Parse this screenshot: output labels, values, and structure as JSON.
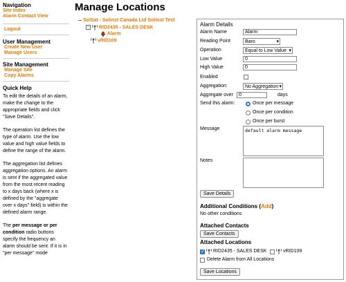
{
  "sidebar": {
    "navigation": {
      "title": "Navigation",
      "links": [
        "Site Index",
        "Alarm Contact View"
      ]
    },
    "logout": "Logout",
    "user_management": {
      "title": "User Management",
      "links": [
        "Create New User",
        "Manage Users"
      ]
    },
    "site_management": {
      "title": "Site Management",
      "links": [
        "Manage Site",
        "Copy Alarms"
      ]
    },
    "quick_help": {
      "title": "Quick Help",
      "p1": "To edit the details of an alarm, make the change to the appropriate fields and click \"Save Details\".",
      "p2": "The operation list defines the type of alarm. Use the low value and high value fields to define the range of the alarm.",
      "p3": "The aggregation list defines aggregation options. An alarm is sent if the aggregated value from the most recent reading to x days back (where x is defined by the \"aggregate over x days\" field) is within the defined alarm range.",
      "p4_bold": "per message or per condition",
      "p4_pre": "The ",
      "p4_post": " radio buttons specify the frequency an alarm should be sent. If it is in \"per message\" mode"
    }
  },
  "page_title": "Manage Locations",
  "tree": {
    "root": "SolSat - Solinst Canada Ltd Solinst Test",
    "site": "RID2435 - SALES DESK",
    "alarm": "Alarm",
    "device": "vRID109"
  },
  "form": {
    "header": "Alarm Details",
    "alarm_name_label": "Alarm Name",
    "alarm_name_value": "Alarm",
    "reading_point_label": "Reading Point",
    "reading_point_value": "Baro",
    "operation_label": "Operation",
    "operation_value": "Equal to Low Value",
    "low_value_label": "Low Value",
    "low_value_value": "0",
    "high_value_label": "High Value",
    "high_value_value": "0",
    "enabled_label": "Enabled",
    "aggregation_label": "Aggregation:",
    "aggregation_value": "No Aggregation",
    "aggregate_over_label": "Aggregate over",
    "aggregate_over_value": "0",
    "days_label": "days",
    "send_label": "Send this alarm:",
    "send_options": [
      "Once per message",
      "Once per condition",
      "Once per burst"
    ],
    "message_label": "Message",
    "message_value": "default alarm message",
    "notes_label": "Notes",
    "notes_value": "",
    "save_details": "Save Details",
    "additional_conditions_title": "Additional Conditions",
    "add_link": "Add",
    "no_conditions": "No other conditions",
    "attached_contacts_title": "Attached Contacts",
    "save_contacts": "Save Contacts",
    "attached_locations_title": "Attached Locations",
    "location_1": "RID2435 - SALES DESK",
    "location_2": "vRID109",
    "delete_alarm_label": "Delete Alarm from All Locations",
    "save_locations": "Save Locations"
  },
  "colors": {
    "link": "#e07b00",
    "accent": "#2f74d0"
  }
}
